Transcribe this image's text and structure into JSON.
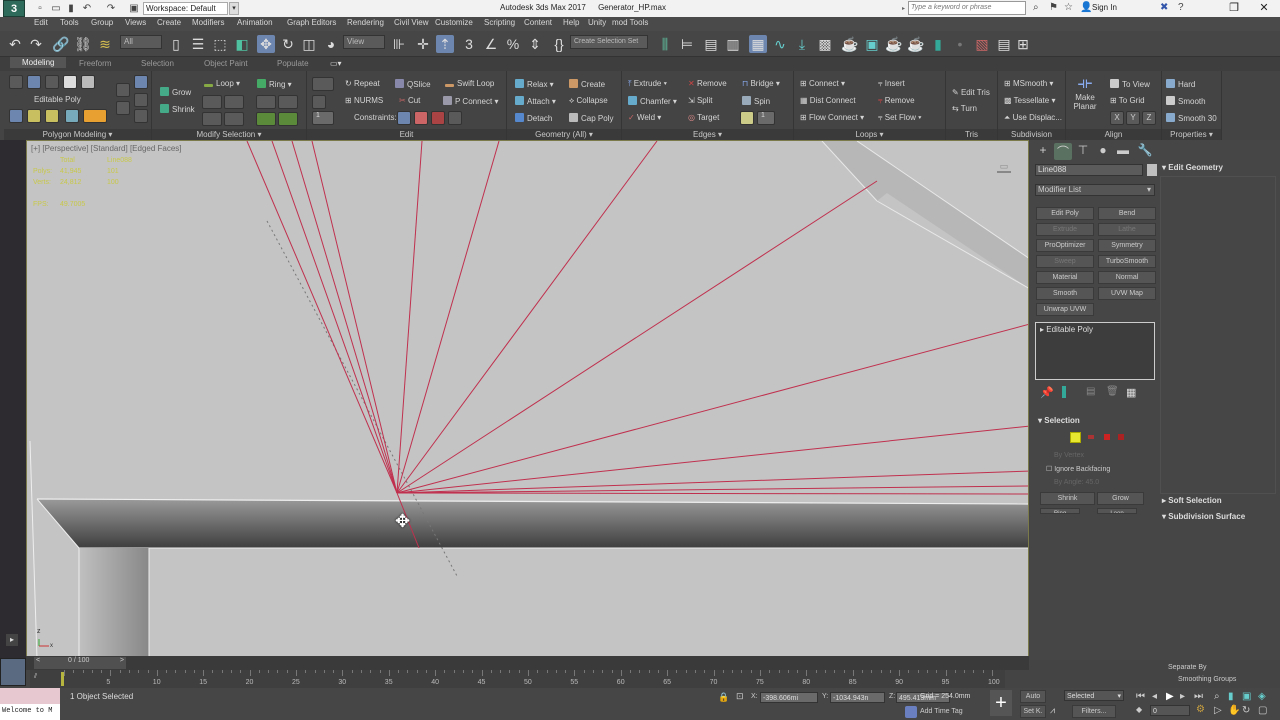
{
  "titlebar": {
    "logo": "3",
    "workspace": "Workspace: Default",
    "app_title": "Autodesk 3ds Max 2017",
    "file_name": "Generator_HP.max",
    "search_placeholder": "Type a keyword or phrase",
    "sign_in": "Sign In"
  },
  "menu": [
    "Edit",
    "Tools",
    "Group",
    "Views",
    "Create",
    "Modifiers",
    "Animation",
    "Graph Editors",
    "Rendering",
    "Civil View",
    "Customize",
    "Scripting",
    "Content",
    "Help",
    "Unity",
    "mod Tools"
  ],
  "main_toolbar": {
    "selection_filter": "All",
    "ref_coord": "View",
    "named_selection": "Create Selection Set"
  },
  "ribbon": {
    "tabs": [
      "Modeling",
      "Freeform",
      "Selection",
      "Object Paint",
      "Populate"
    ],
    "active_tab": "Modeling",
    "groups": {
      "polygon_modeling": {
        "label": "Polygon Modeling",
        "mode": "Editable Poly"
      },
      "modify_selection": {
        "label": "Modify Selection",
        "grow": "Grow",
        "shrink": "Shrink",
        "loop": "Loop",
        "ring": "Ring"
      },
      "edit": {
        "label": "Edit",
        "repeat": "Repeat",
        "qslice": "QSlice",
        "swift_loop": "Swift Loop",
        "nurms": "NURMS",
        "cut": "Cut",
        "p_connect": "P Connect",
        "constraints": "Constraints:",
        "spinner": "1"
      },
      "geometry": {
        "label": "Geometry (All)",
        "relax": "Relax",
        "create": "Create",
        "attach": "Attach",
        "collapse": "Collapse",
        "detach": "Detach",
        "cap_poly": "Cap Poly"
      },
      "edges": {
        "label": "Edges",
        "extrude": "Extrude",
        "remove": "Remove",
        "bridge": "Bridge",
        "chamfer": "Chamfer",
        "split": "Split",
        "spin": "Spin",
        "weld": "Weld",
        "target": "Target",
        "spinner": "1"
      },
      "loops": {
        "label": "Loops",
        "connect": "Connect",
        "insert": "Insert",
        "dist_connect": "Dist Connect",
        "remove": "Remove",
        "flow_connect": "Flow Connect",
        "set_flow": "Set Flow"
      },
      "tris": {
        "label": "Tris",
        "edit_tris": "Edit Tris",
        "turn": "Turn"
      },
      "subdivision": {
        "label": "Subdivision",
        "msmooth": "MSmooth",
        "tessellate": "Tessellate",
        "use_displace": "Use Displac..."
      },
      "align": {
        "label": "Align",
        "make_planar_1": "Make",
        "make_planar_2": "Planar",
        "to_view": "To View",
        "to_grid": "To Grid",
        "x": "X",
        "y": "Y",
        "z": "Z"
      },
      "properties": {
        "label": "Properties",
        "hard": "Hard",
        "smooth": "Smooth",
        "smooth30": "Smooth 30"
      }
    }
  },
  "viewport": {
    "label": "[+] [Perspective] [Standard] [Edged Faces]",
    "stats": {
      "col_total": "Total",
      "col_object": "Line088",
      "polys_label": "Polys:",
      "polys_total": "41,945",
      "polys_object": "101",
      "verts_label": "Verts:",
      "verts_total": "24,812",
      "verts_object": "100",
      "fps_label": "FPS:",
      "fps_value": "49.7005"
    }
  },
  "command_panel": {
    "object_name": "Line088",
    "modifier_list": "Modifier List",
    "modifier_buttons": [
      {
        "label": "Edit Poly",
        "enabled": true
      },
      {
        "label": "Bend",
        "enabled": true
      },
      {
        "label": "Extrude",
        "enabled": false
      },
      {
        "label": "Lathe",
        "enabled": false
      },
      {
        "label": "ProOptimizer",
        "enabled": true
      },
      {
        "label": "Symmetry",
        "enabled": true
      },
      {
        "label": "Sweep",
        "enabled": false
      },
      {
        "label": "TurboSmooth",
        "enabled": true
      },
      {
        "label": "Material",
        "enabled": true
      },
      {
        "label": "Normal",
        "enabled": true
      },
      {
        "label": "Smooth",
        "enabled": true
      },
      {
        "label": "UVW Map",
        "enabled": true
      },
      {
        "label": "Unwrap UVW",
        "enabled": true
      }
    ],
    "stack_item": "Editable Poly",
    "rollouts": {
      "selection": "Selection",
      "by_vertex": "By Vertex",
      "ignore_backfacing": "Ignore Backfacing",
      "by_angle": "By Angle:",
      "by_angle_value": "45.0",
      "shrink": "Shrink",
      "grow": "Grow",
      "ring": "Ring",
      "loop": "Loop",
      "edit_geometry": "Edit Geometry",
      "soft_selection": "Soft Selection",
      "subdivision_surface": "Subdivision Surface",
      "separate_by": "Separate By",
      "smoothing_groups": "Smoothing Groups"
    }
  },
  "timeline": {
    "frame_display": "0 / 100",
    "ticks": [
      "0",
      "5",
      "10",
      "15",
      "20",
      "25",
      "30",
      "35",
      "40",
      "45",
      "50",
      "55",
      "60",
      "65",
      "70",
      "75",
      "80",
      "85",
      "90",
      "95",
      "100"
    ]
  },
  "status": {
    "maxscript": "Welcome to M",
    "selection_status": "1 Object Selected",
    "x_label": "X:",
    "x_value": "-398.606mi",
    "y_label": "Y:",
    "y_value": "-1034.943n",
    "z_label": "Z:",
    "z_value": "495.413mm",
    "grid": "Grid = 254.0mm",
    "add_time_tag": "Add Time Tag",
    "auto_key": "Auto",
    "set_key": "Set K.",
    "key_filter": "Selected",
    "filters": "Filters...",
    "current_frame": "0"
  },
  "colors": {
    "accent": "#6d86b0",
    "edge_red": "#c0304e",
    "viewport_bg": "#c4c4c4",
    "stats_yellow": "#c8c84a"
  }
}
